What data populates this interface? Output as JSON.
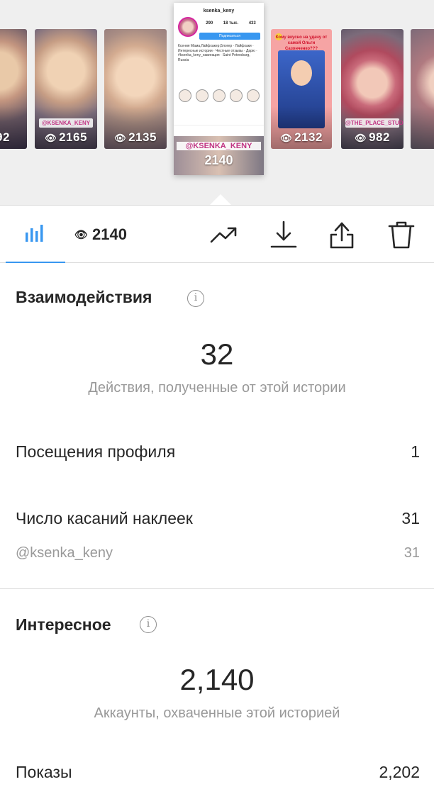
{
  "carousel": {
    "thumbs": [
      {
        "views": "92",
        "tag": ""
      },
      {
        "views": "2165",
        "tag": "@KSENKA_KENY"
      },
      {
        "views": "2135",
        "tag": ""
      },
      {
        "views": "2132",
        "tag": "",
        "caption": "Кому вкусно на удачу от самой Ольги Сазонченко???"
      },
      {
        "views": "982",
        "tag": "@THE_PLACE_STUDIO"
      },
      {
        "views": "",
        "tag": ""
      }
    ],
    "selected": {
      "username": "ksenka_keny",
      "stats": [
        "290",
        "18 тыс.",
        "433"
      ],
      "follow_label": "Подписаться",
      "bio": "Ксения Мама,Лайфхакер,Блогер · Лайфхаки · Интересные истории · Честные отзывы · Дарю · #ksenka_keny_навигация · Saint Petersburg, Russia",
      "tag": "@KSENKA_KENY",
      "views": "2140"
    }
  },
  "toolbar": {
    "views": "2140",
    "icons": [
      "bar-chart-icon",
      "eye-icon",
      "trend-icon",
      "download-icon",
      "share-icon",
      "trash-icon"
    ]
  },
  "interactions": {
    "title": "Взаимодействия",
    "total": "32",
    "caption": "Действия, полученные от этой истории",
    "rows": [
      {
        "label": "Посещения профиля",
        "value": "1"
      },
      {
        "label": "Число касаний наклеек",
        "value": "31"
      },
      {
        "label": "@ksenka_keny",
        "value": "31"
      }
    ]
  },
  "discovery": {
    "title": "Интересное",
    "total": "2,140",
    "caption": "Аккаунты, охваченные этой историей",
    "rows": [
      {
        "label": "Показы",
        "value": "2,202"
      }
    ]
  },
  "colors": {
    "accent": "#3897f0",
    "text": "#262626",
    "secondary": "#999999",
    "divider": "#dbdbdb"
  }
}
